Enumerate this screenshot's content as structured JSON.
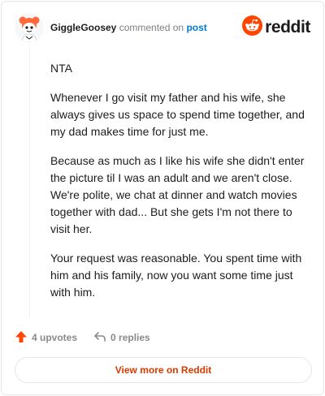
{
  "header": {
    "username": "GiggleGoosey",
    "action_text": "commented on",
    "post_link": "post",
    "brand": "reddit",
    "avatar_icon": "snoo-avatar-icon",
    "brand_icon": "reddit-logo-icon"
  },
  "comment": {
    "paragraphs": [
      "NTA",
      "Whenever I go visit my father and his wife, she always gives us space to spend time together, and my dad makes time for just me.",
      "Because as much as I like his wife she didn't enter the picture til I was an adult and we aren't close. We're polite, we chat at dinner and watch movies together with dad... But she gets I'm not there to visit her.",
      "Your request was reasonable. You spent time with him and his family, now you want some time just with him."
    ]
  },
  "actions": {
    "upvotes": "4 upvotes",
    "replies": "0 replies"
  },
  "cta": {
    "label": "View more on Reddit"
  },
  "colors": {
    "accent": "#ff4500",
    "link": "#0079d3",
    "cta_text": "#d93a00"
  }
}
